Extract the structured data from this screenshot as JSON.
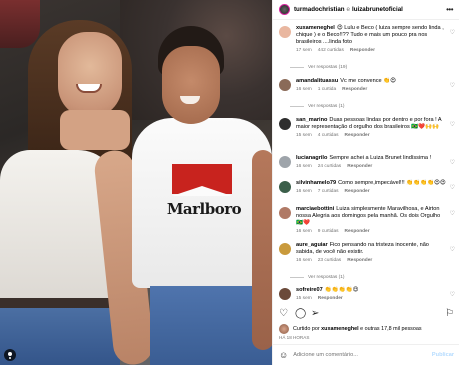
{
  "post": {
    "author": "turmadochristian",
    "coauthor": "luizabrunetoficial",
    "separator": "e"
  },
  "comments": [
    {
      "username": "xuxameneghel",
      "text": "😍 Lulu e Beco ( luiza sempre sendo linda , chique ) e o Beco!!?? Tudo e mais um pouco pra nos brasileiros ....linda foto",
      "time": "17 sem",
      "likes": "442 curtidas",
      "reply": "Responder",
      "view_replies": "Ver respostas (19)",
      "avatar_color": "#e9b7a0"
    },
    {
      "username": "amandalituassu",
      "text": "Vc me convence 👏😍",
      "time": "16 sem",
      "likes": "1 curtida",
      "reply": "Responder",
      "view_replies": "Ver respostas (1)",
      "avatar_color": "#8a6a58"
    },
    {
      "username": "san_marino",
      "text": "Duas pessoas lindas por dentro e por fora ! A maior representação d orgulho dos brasileiros 🇧🇷❤️🙌🙌",
      "time": "15 sem",
      "likes": "4 curtidas",
      "reply": "Responder",
      "avatar_color": "#2d2d2d"
    },
    {
      "username": "lucianagrilo",
      "text": "Sempre achei a Luiza Brunet lindíssima !",
      "time": "16 sem",
      "likes": "24 curtidas",
      "reply": "Responder",
      "avatar_color": "#9ea4aa"
    },
    {
      "username": "silvinhamelo79",
      "text": "Como sempre,impecável!!! 👏👏👏👏😍😍",
      "time": "16 sem",
      "likes": "7 curtidas",
      "reply": "Responder",
      "avatar_color": "#3b5f4a"
    },
    {
      "username": "marciaebottini",
      "text": "Luiza simplesmente Maravilhosa, e Airton nossa Alegria aos domingos pela manhã. Os dois Orgulho 🇧🇷❤️",
      "time": "16 sem",
      "likes": "9 curtidas",
      "reply": "Responder",
      "avatar_color": "#b07a66"
    },
    {
      "username": "aure_aguiar",
      "text": "Fico pensando na tristeza inocente, não sabida, de você não existir.",
      "time": "16 sem",
      "likes": "23 curtidas",
      "reply": "Responder",
      "view_replies": "Ver respostas (1)",
      "avatar_color": "#c99a3c"
    },
    {
      "username": "sofreire07",
      "text": "👏👏👏👏😍",
      "time": "15 sem",
      "likes": "",
      "reply": "Responder",
      "avatar_color": "#6b4a3a"
    }
  ],
  "liked_by": {
    "prefix": "Curtido por",
    "user": "xuxameneghel",
    "suffix": "e outras 17,8 mil pessoas"
  },
  "post_time": "HÁ 18 HORAS",
  "add_comment": {
    "placeholder": "Adicione um comentário...",
    "publish_label": "Publicar"
  },
  "photo": {
    "shirt_brand": "Marlboro"
  },
  "icons": {
    "more": "more-icon",
    "heart": "heart-icon",
    "comment": "comment-icon",
    "share": "share-icon",
    "bookmark": "bookmark-icon",
    "emoji": "emoji-icon",
    "tag": "tag-icon"
  }
}
